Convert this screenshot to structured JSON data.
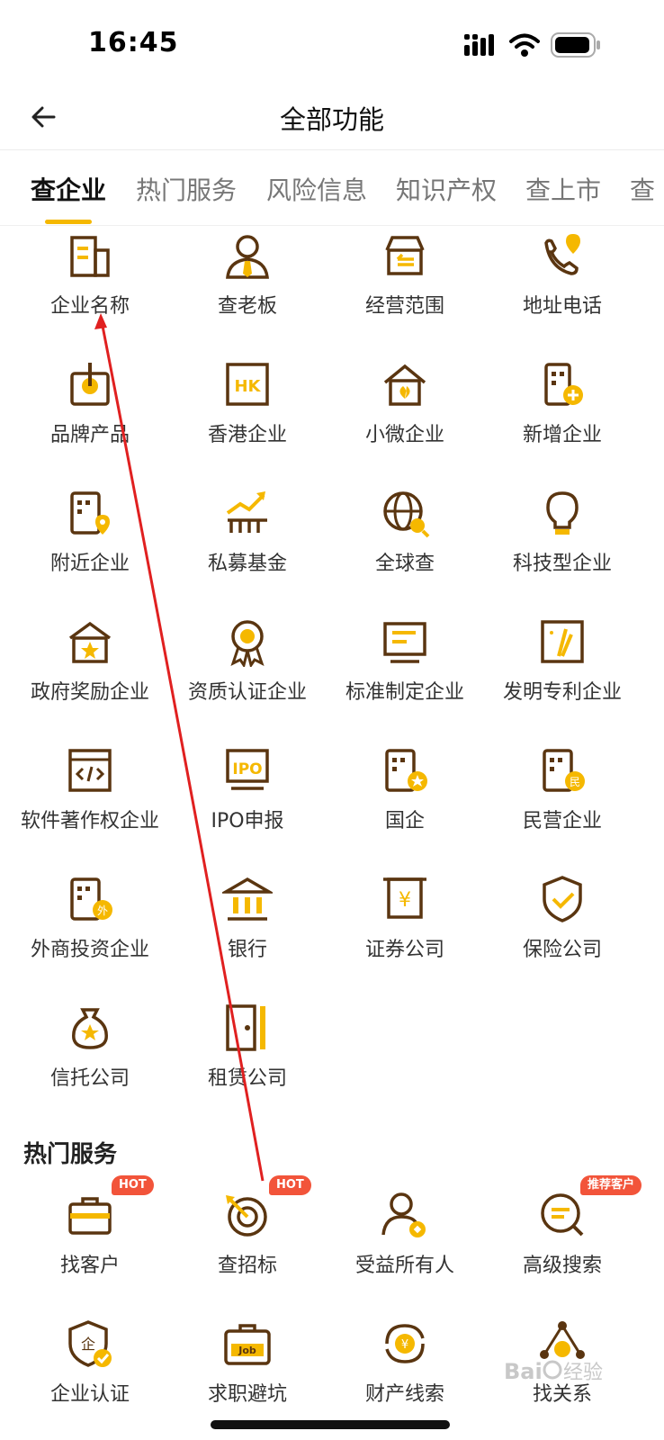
{
  "status_bar": {
    "time": "16:45"
  },
  "nav": {
    "title": "全部功能"
  },
  "tabs": [
    {
      "label": "查企业",
      "active": true
    },
    {
      "label": "热门服务"
    },
    {
      "label": "风险信息"
    },
    {
      "label": "知识产权"
    },
    {
      "label": "查上市"
    },
    {
      "label": "查"
    }
  ],
  "colors": {
    "accent": "#f5b800",
    "icon_brown": "#5a3510",
    "badge_red": "#f2543a",
    "annotation_red": "#e02020"
  },
  "company_items": [
    {
      "label": "企业名称",
      "icon": "building-icon"
    },
    {
      "label": "查老板",
      "icon": "boss-icon"
    },
    {
      "label": "经营范围",
      "icon": "store-icon"
    },
    {
      "label": "地址电话",
      "icon": "phone-location-icon"
    },
    {
      "label": "品牌产品",
      "icon": "brand-icon"
    },
    {
      "label": "香港企业",
      "icon": "hk-icon"
    },
    {
      "label": "小微企业",
      "icon": "small-business-icon"
    },
    {
      "label": "新增企业",
      "icon": "new-company-icon"
    },
    {
      "label": "附近企业",
      "icon": "nearby-icon"
    },
    {
      "label": "私募基金",
      "icon": "fund-icon"
    },
    {
      "label": "全球查",
      "icon": "globe-icon"
    },
    {
      "label": "科技型企业",
      "icon": "bulb-icon"
    },
    {
      "label": "政府奖励企业",
      "icon": "gov-award-icon"
    },
    {
      "label": "资质认证企业",
      "icon": "certificate-icon"
    },
    {
      "label": "标准制定企业",
      "icon": "standard-icon"
    },
    {
      "label": "发明专利企业",
      "icon": "patent-icon"
    },
    {
      "label": "软件著作权企业",
      "icon": "code-icon"
    },
    {
      "label": "IPO申报",
      "icon": "ipo-icon"
    },
    {
      "label": "国企",
      "icon": "state-owned-icon"
    },
    {
      "label": "民营企业",
      "icon": "private-icon"
    },
    {
      "label": "外商投资企业",
      "icon": "foreign-icon"
    },
    {
      "label": "银行",
      "icon": "bank-icon"
    },
    {
      "label": "证券公司",
      "icon": "securities-icon"
    },
    {
      "label": "保险公司",
      "icon": "shield-check-icon"
    },
    {
      "label": "信托公司",
      "icon": "money-bag-icon"
    },
    {
      "label": "租赁公司",
      "icon": "door-icon"
    }
  ],
  "hot_section": {
    "title": "热门服务"
  },
  "hot_items": [
    {
      "label": "找客户",
      "icon": "briefcase-icon",
      "badge": "HOT"
    },
    {
      "label": "查招标",
      "icon": "target-icon",
      "badge": "HOT"
    },
    {
      "label": "受益所有人",
      "icon": "beneficiary-icon"
    },
    {
      "label": "高级搜索",
      "icon": "advanced-search-icon",
      "badge": "推荐客户"
    },
    {
      "label": "企业认证",
      "icon": "company-verify-icon"
    },
    {
      "label": "求职避坑",
      "icon": "job-icon"
    },
    {
      "label": "财产线索",
      "icon": "property-icon"
    },
    {
      "label": "找关系",
      "icon": "relation-icon"
    }
  ],
  "watermark": {
    "text": "Bai du 经验"
  }
}
